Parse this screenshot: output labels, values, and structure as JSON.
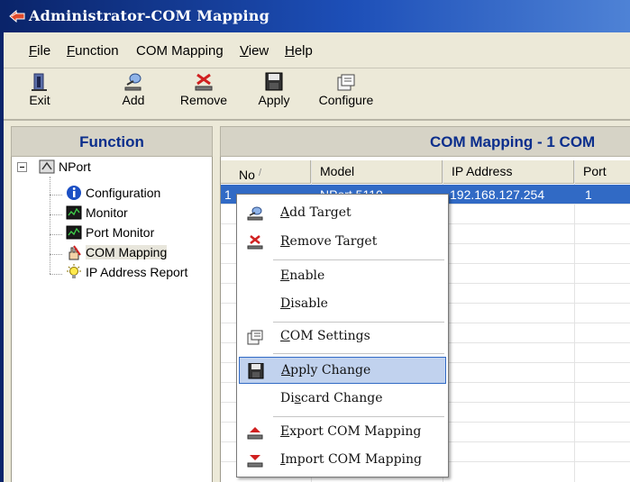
{
  "window": {
    "title": "Administrator-COM Mapping"
  },
  "menubar": {
    "items": [
      {
        "label": "File",
        "key": "F",
        "rest": "ile"
      },
      {
        "label": "Function",
        "key": "F",
        "rest": "unction"
      },
      {
        "label": "COM Mapping",
        "key": "",
        "rest": "COM Mapping"
      },
      {
        "label": "View",
        "key": "V",
        "rest": "iew"
      },
      {
        "label": "Help",
        "key": "H",
        "rest": "elp"
      }
    ]
  },
  "toolbar": {
    "exit_label": "Exit",
    "add_label": "Add",
    "remove_label": "Remove",
    "apply_label": "Apply",
    "configure_label": "Configure"
  },
  "left_panel": {
    "header": "Function",
    "tree": {
      "root": "NPort",
      "children": [
        "Configuration",
        "Monitor",
        "Port Monitor",
        "COM Mapping",
        "IP Address Report"
      ]
    }
  },
  "right_panel": {
    "header": "COM Mapping - 1 COM",
    "columns": [
      "No",
      "Model",
      "IP Address",
      "Port"
    ],
    "sort_indicator": "/",
    "rows": [
      {
        "no": "1",
        "model": "NPort 5110",
        "ip": "192.168.127.254",
        "port": "1"
      }
    ]
  },
  "context_menu": {
    "items": [
      {
        "key": "A",
        "rest": "dd Target",
        "icon": "add-target-icon"
      },
      {
        "key": "R",
        "rest": "emove Target",
        "icon": "remove-target-icon"
      },
      {
        "key": "E",
        "rest": "nable",
        "icon": ""
      },
      {
        "key": "D",
        "rest": "isable",
        "icon": ""
      },
      {
        "key": "C",
        "rest": "OM Settings",
        "icon": "com-settings-icon"
      },
      {
        "key": "A",
        "rest": "pply Change",
        "icon": "apply-change-icon",
        "highlighted": true
      },
      {
        "key": "Di",
        "keyed": "s",
        "rest2": "card Change",
        "icon": ""
      },
      {
        "key": "E",
        "rest": "xport COM Mapping",
        "icon": "export-icon"
      },
      {
        "key": "I",
        "rest": "mport COM Mapping",
        "icon": "import-icon"
      }
    ]
  },
  "colors": {
    "title_gradient_start": "#0a246a",
    "header_text": "#0b2e8c",
    "selection": "#316ac5",
    "menu_highlight": "#c1d2ee"
  }
}
